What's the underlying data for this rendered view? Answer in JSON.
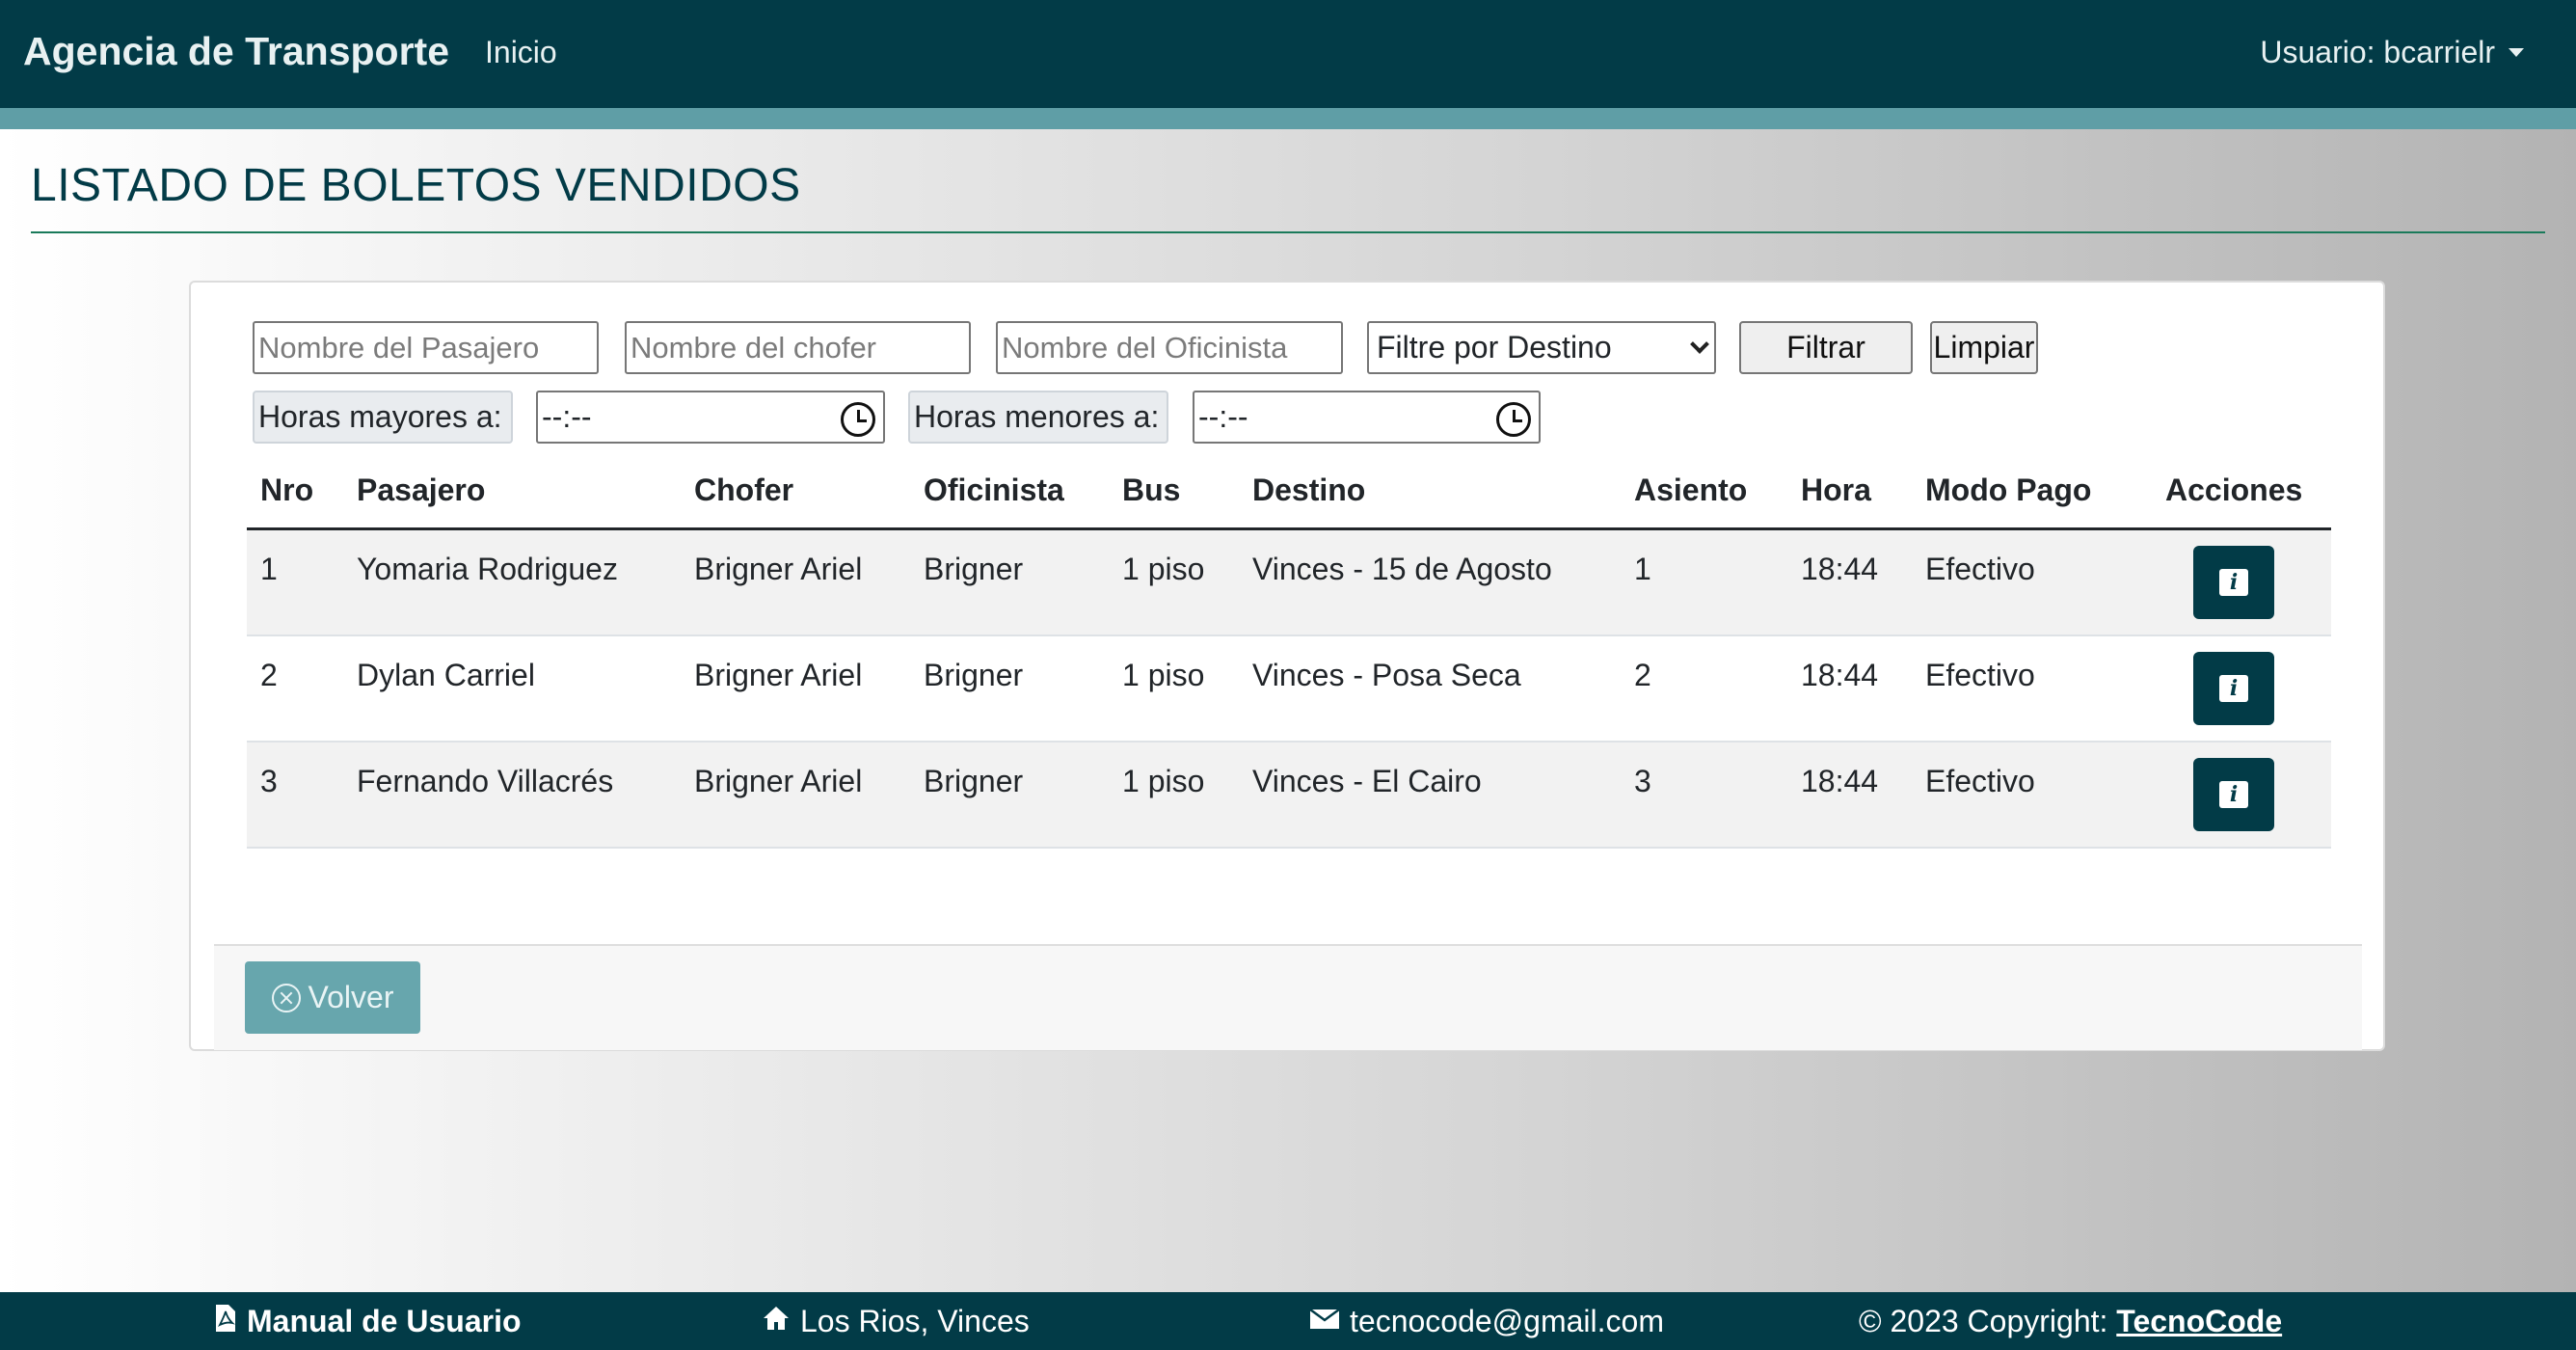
{
  "navbar": {
    "brand": "Agencia de Transporte",
    "home_link": "Inicio",
    "user_label": "Usuario: bcarrielr"
  },
  "page": {
    "title": "LISTADO DE BOLETOS VENDIDOS"
  },
  "filters": {
    "passenger_placeholder": "Nombre del Pasajero",
    "driver_placeholder": "Nombre del chofer",
    "clerk_placeholder": "Nombre del Oficinista",
    "destination_select": "Filtre por Destino",
    "filter_button": "Filtrar",
    "clear_button": "Limpiar",
    "hours_greater_label": "Horas mayores a:",
    "hours_greater_value": "--:--",
    "hours_less_label": "Horas menores a:",
    "hours_less_value": "--:--"
  },
  "table": {
    "headers": [
      "Nro",
      "Pasajero",
      "Chofer",
      "Oficinista",
      "Bus",
      "Destino",
      "Asiento",
      "Hora",
      "Modo Pago",
      "Acciones"
    ],
    "rows": [
      [
        "1",
        "Yomaria Rodriguez",
        "Brigner Ariel",
        "Brigner",
        "1 piso",
        "Vinces - 15 de Agosto",
        "1",
        "18:44",
        "Efectivo"
      ],
      [
        "2",
        "Dylan Carriel",
        "Brigner Ariel",
        "Brigner",
        "1 piso",
        "Vinces - Posa Seca",
        "2",
        "18:44",
        "Efectivo"
      ],
      [
        "3",
        "Fernando Villacrés",
        "Brigner Ariel",
        "Brigner",
        "1 piso",
        "Vinces - El Cairo",
        "3",
        "18:44",
        "Efectivo"
      ]
    ],
    "action_glyph": "i"
  },
  "card_footer": {
    "back_button": "Volver"
  },
  "footer": {
    "manual": "Manual de Usuario",
    "location": "Los Rios, Vinces",
    "email": "tecnocode@gmail.com",
    "copyright": "© 2023 Copyright: ",
    "company": "TecnoCode"
  },
  "colors": {
    "primary": "#023b47",
    "accent": "#5f9ea6",
    "button_back": "#67a6ad"
  },
  "icons": {
    "manual": "pdf-file-icon",
    "location": "house-icon",
    "email": "envelope-icon",
    "back": "x-circle-icon",
    "time": "clock-icon",
    "action": "info-icon"
  }
}
